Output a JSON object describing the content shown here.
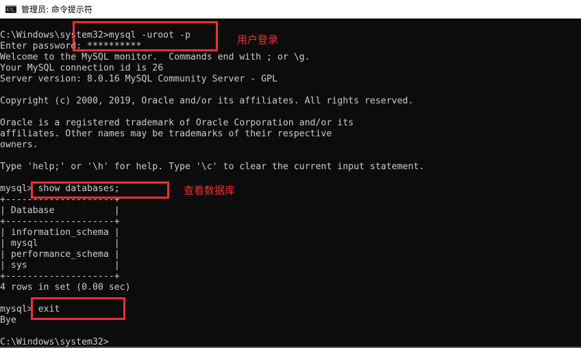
{
  "window": {
    "title": "管理员: 命令提示符",
    "icon": "cmd-icon",
    "icon_text": "C:\\_"
  },
  "console": {
    "lines": [
      "C:\\Windows\\system32>mysql -uroot -p",
      "Enter password: **********",
      "Welcome to the MySQL monitor.  Commands end with ; or \\g.",
      "Your MySQL connection id is 26",
      "Server version: 8.0.16 MySQL Community Server - GPL",
      "",
      "Copyright (c) 2000, 2019, Oracle and/or its affiliates. All rights reserved.",
      "",
      "Oracle is a registered trademark of Oracle Corporation and/or its",
      "affiliates. Other names may be trademarks of their respective",
      "owners.",
      "",
      "Type 'help;' or '\\h' for help. Type '\\c' to clear the current input statement.",
      "",
      "mysql> show databases;",
      "+--------------------+",
      "| Database           |",
      "+--------------------+",
      "| information_schema |",
      "| mysql              |",
      "| performance_schema |",
      "| sys                |",
      "+--------------------+",
      "4 rows in set (0.00 sec)",
      "",
      "mysql> exit",
      "Bye",
      "",
      "C:\\Windows\\system32>"
    ]
  },
  "annotations": [
    {
      "label": "用户登录",
      "target": "mysql -uroot -p"
    },
    {
      "label": "查看数据库",
      "target": "show databases;"
    },
    {
      "label": "",
      "target": "exit"
    }
  ],
  "colors": {
    "console_bg": "#0c0c0c",
    "console_text": "#cccccc",
    "annotation_red": "#ee3232"
  }
}
